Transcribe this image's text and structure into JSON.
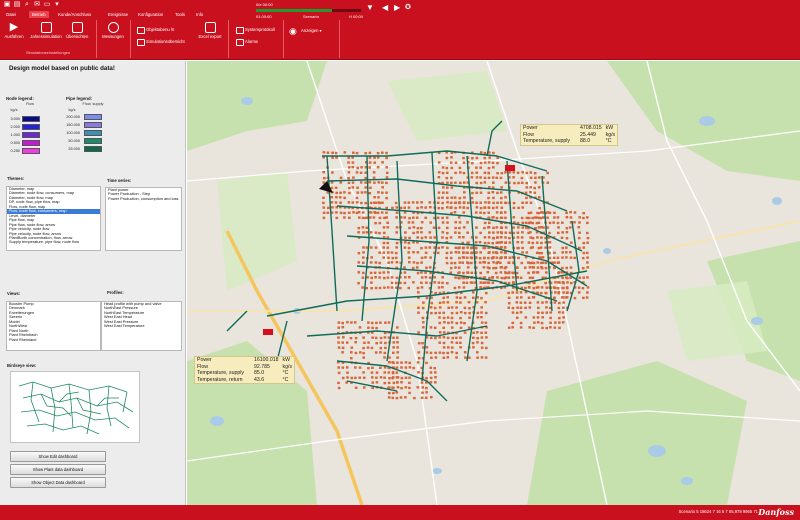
{
  "window": {
    "menu_tabs": [
      {
        "label": "Datei"
      },
      {
        "label": "Betrieb"
      },
      {
        "label": "Kunde/Anschluss"
      },
      {
        "label": "Ereignisse"
      },
      {
        "label": "Konfiguration"
      },
      {
        "label": "Tools"
      },
      {
        "label": "Info"
      }
    ]
  },
  "ribbon": {
    "run_label": "Ausführen",
    "annual_label": "Jahressimulation",
    "overview_label": "Übersichten",
    "measure_label": "Messungen",
    "objects_label": "Objektabenu ht",
    "simoverview_label": "Simulationsübersicht",
    "export_label": "Excel export",
    "system_label": "Systemprotokoll",
    "alarms_label": "Alarme",
    "view_label": "Anzeigen",
    "group_label": "Simulationseinstellungen"
  },
  "time": {
    "start": "01.00:00",
    "current": "0/e 00:00",
    "mid": "Szenario",
    "end": "H 00:00",
    "progress": 0.72
  },
  "left": {
    "title": "Design model based on public data!",
    "node_legend": {
      "title": "Node legend:",
      "sub": "Flow",
      "unit": "kg/s",
      "values": [
        "3.000",
        "2.000",
        "1.000",
        "0.500",
        "0.250"
      ],
      "colors": [
        "#0a0a8c",
        "#2222dd",
        "#6a2ad6",
        "#c41ad6",
        "#f03ce0"
      ]
    },
    "pipe_legend": {
      "title": "Pipe legend:",
      "sub": "Flow, supply",
      "unit": "kg/s",
      "values": [
        "200.000",
        "150.000",
        "100.000",
        "50.000",
        "25.000"
      ],
      "colors": [
        "#7a8cf0",
        "#8a7ae0",
        "#3d8fb8",
        "#1f8a6a",
        "#0e6b4a"
      ]
    },
    "themes_label": "Themes:",
    "themes": [
      "Diameter, map",
      "Diameter, node flow, consumers, map",
      "Diameter, node flow, map",
      "DP, node flow, pipe flow, map",
      "Flow, node flow, map",
      "Flow, node flow, consumers, map",
      "Level, diameter",
      "Pipe flow, map",
      "Pipe flow, node flow, arrow",
      "Pipe velocity, node flow",
      "Pipe velocity, node flow, arrow",
      "PlantBorth concentration, flow, arrow",
      "Supply temperature, pipe flow, node flow"
    ],
    "themes_selected": 5,
    "timeseries_label": "Time series:",
    "timeseries": [
      "Plant power",
      "Power Production - Step",
      "Power Production, consumption and loss"
    ],
    "views_label": "Views:",
    "views": [
      "Booster Pump",
      "Denmark",
      "Erweiterungen",
      "Szeerio",
      "Model",
      "NorthWest",
      "Plant North",
      "Plant Rheinbach",
      "Plant Rheinland"
    ],
    "profiles_label": "Profiles:",
    "profiles": [
      "Head profile with pump and valve",
      "NorthEast Pressure",
      "NorthEast Temperature",
      "West East Head",
      "West East Pressure",
      "West East Temperature"
    ],
    "birdseye_label": "Birdseye view:",
    "buttons": [
      "Show Edit dashboard",
      "Show Plant data dashboard",
      "Show Object Data dashboard"
    ]
  },
  "map": {
    "info_top": [
      {
        "k": "Power",
        "v": "4708.015",
        "u": "kW"
      },
      {
        "k": "Flow",
        "v": "25.449",
        "u": "kg/s"
      },
      {
        "k": "Temperature, supply",
        "v": "88.0",
        "u": "°C"
      }
    ],
    "info_bottom": [
      {
        "k": "Power",
        "v": "16100.018",
        "u": "kW"
      },
      {
        "k": "Flow",
        "v": "92.785",
        "u": "kg/s"
      },
      {
        "k": "Temperature, supply",
        "v": "85.0",
        "u": "°C"
      },
      {
        "k": "Temperature, return",
        "v": "43.6",
        "u": "°C"
      }
    ],
    "colors": {
      "pipe": "#0f6b5a",
      "house": "#d9653a",
      "forest": "#bfe0a5",
      "road": "#f4c55c",
      "water": "#a9cbe6",
      "plant": "#d4101e"
    }
  },
  "status": {
    "scenario": "Scenario  5 18624 7 16 5 7 55,978 9965 71",
    "logo": "Danfoss"
  }
}
